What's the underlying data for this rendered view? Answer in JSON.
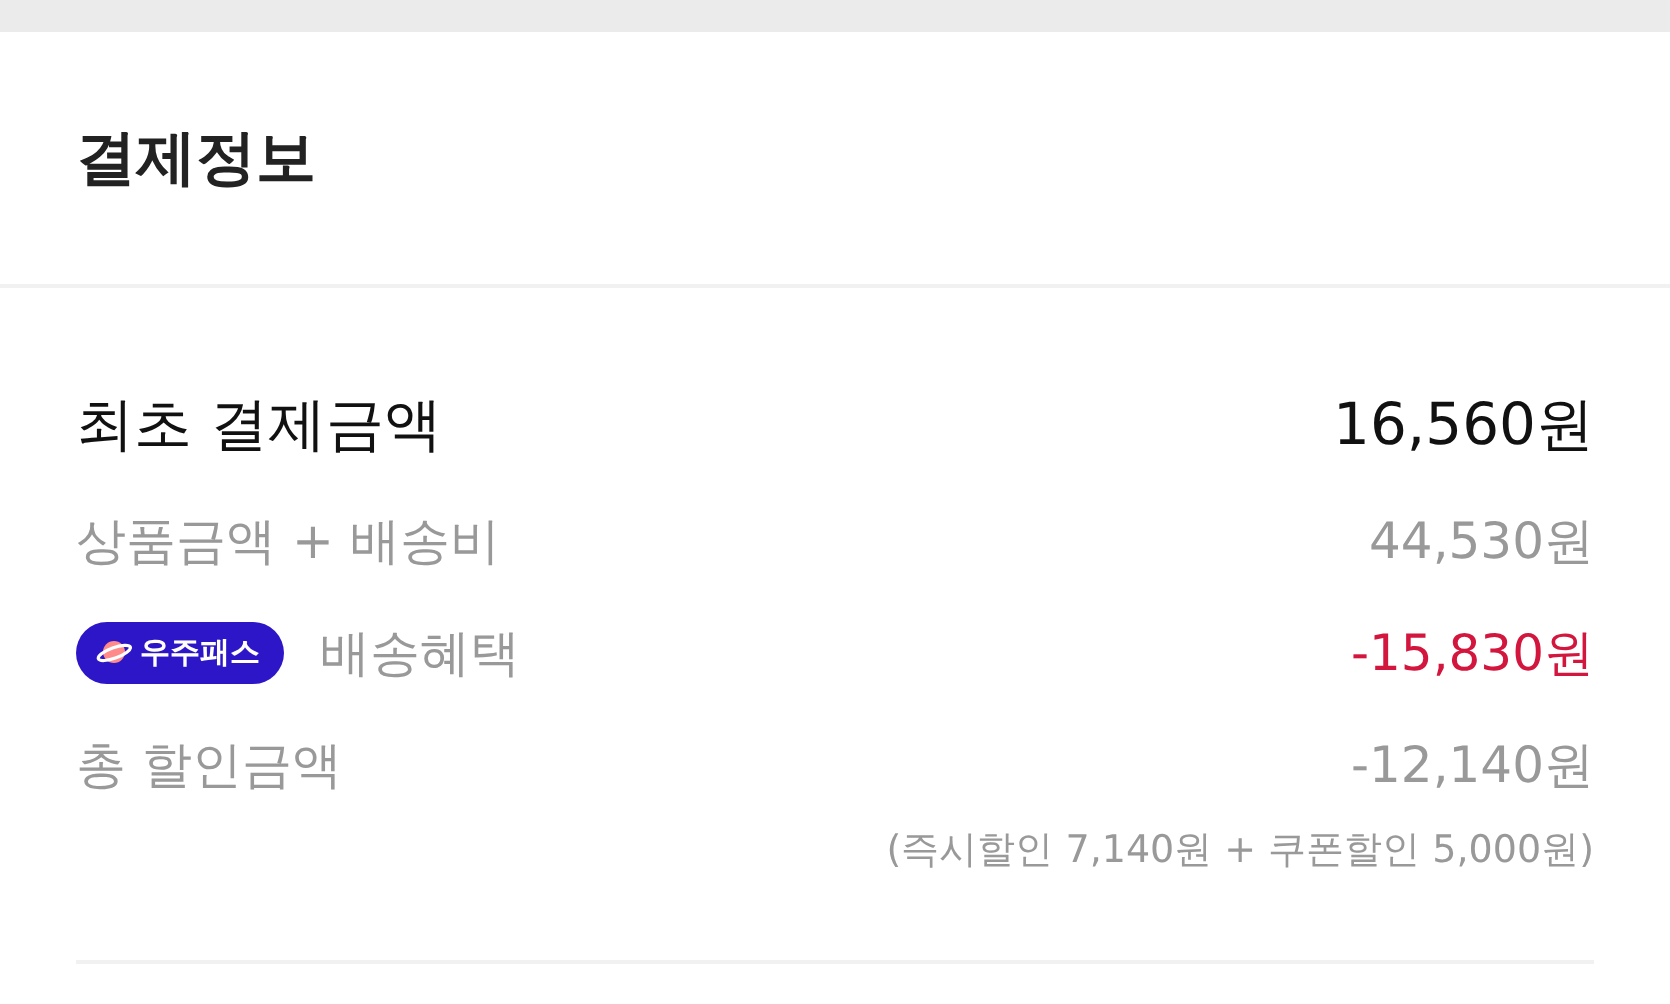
{
  "header": {
    "title": "결제정보"
  },
  "rows": [
    {
      "kind": "total",
      "label": "최초 결제금액",
      "amount": "16,560원"
    },
    {
      "kind": "item",
      "label": "상품금액 + 배송비",
      "amount": "44,530원"
    },
    {
      "kind": "benefit",
      "badge": "우주패스",
      "label": "배송혜택",
      "amount": "-15,830원"
    },
    {
      "kind": "item",
      "label": "총 할인금액",
      "amount": "-12,140원",
      "note": "(즉시할인 7,140원 + 쿠폰할인 5,000원)"
    }
  ]
}
